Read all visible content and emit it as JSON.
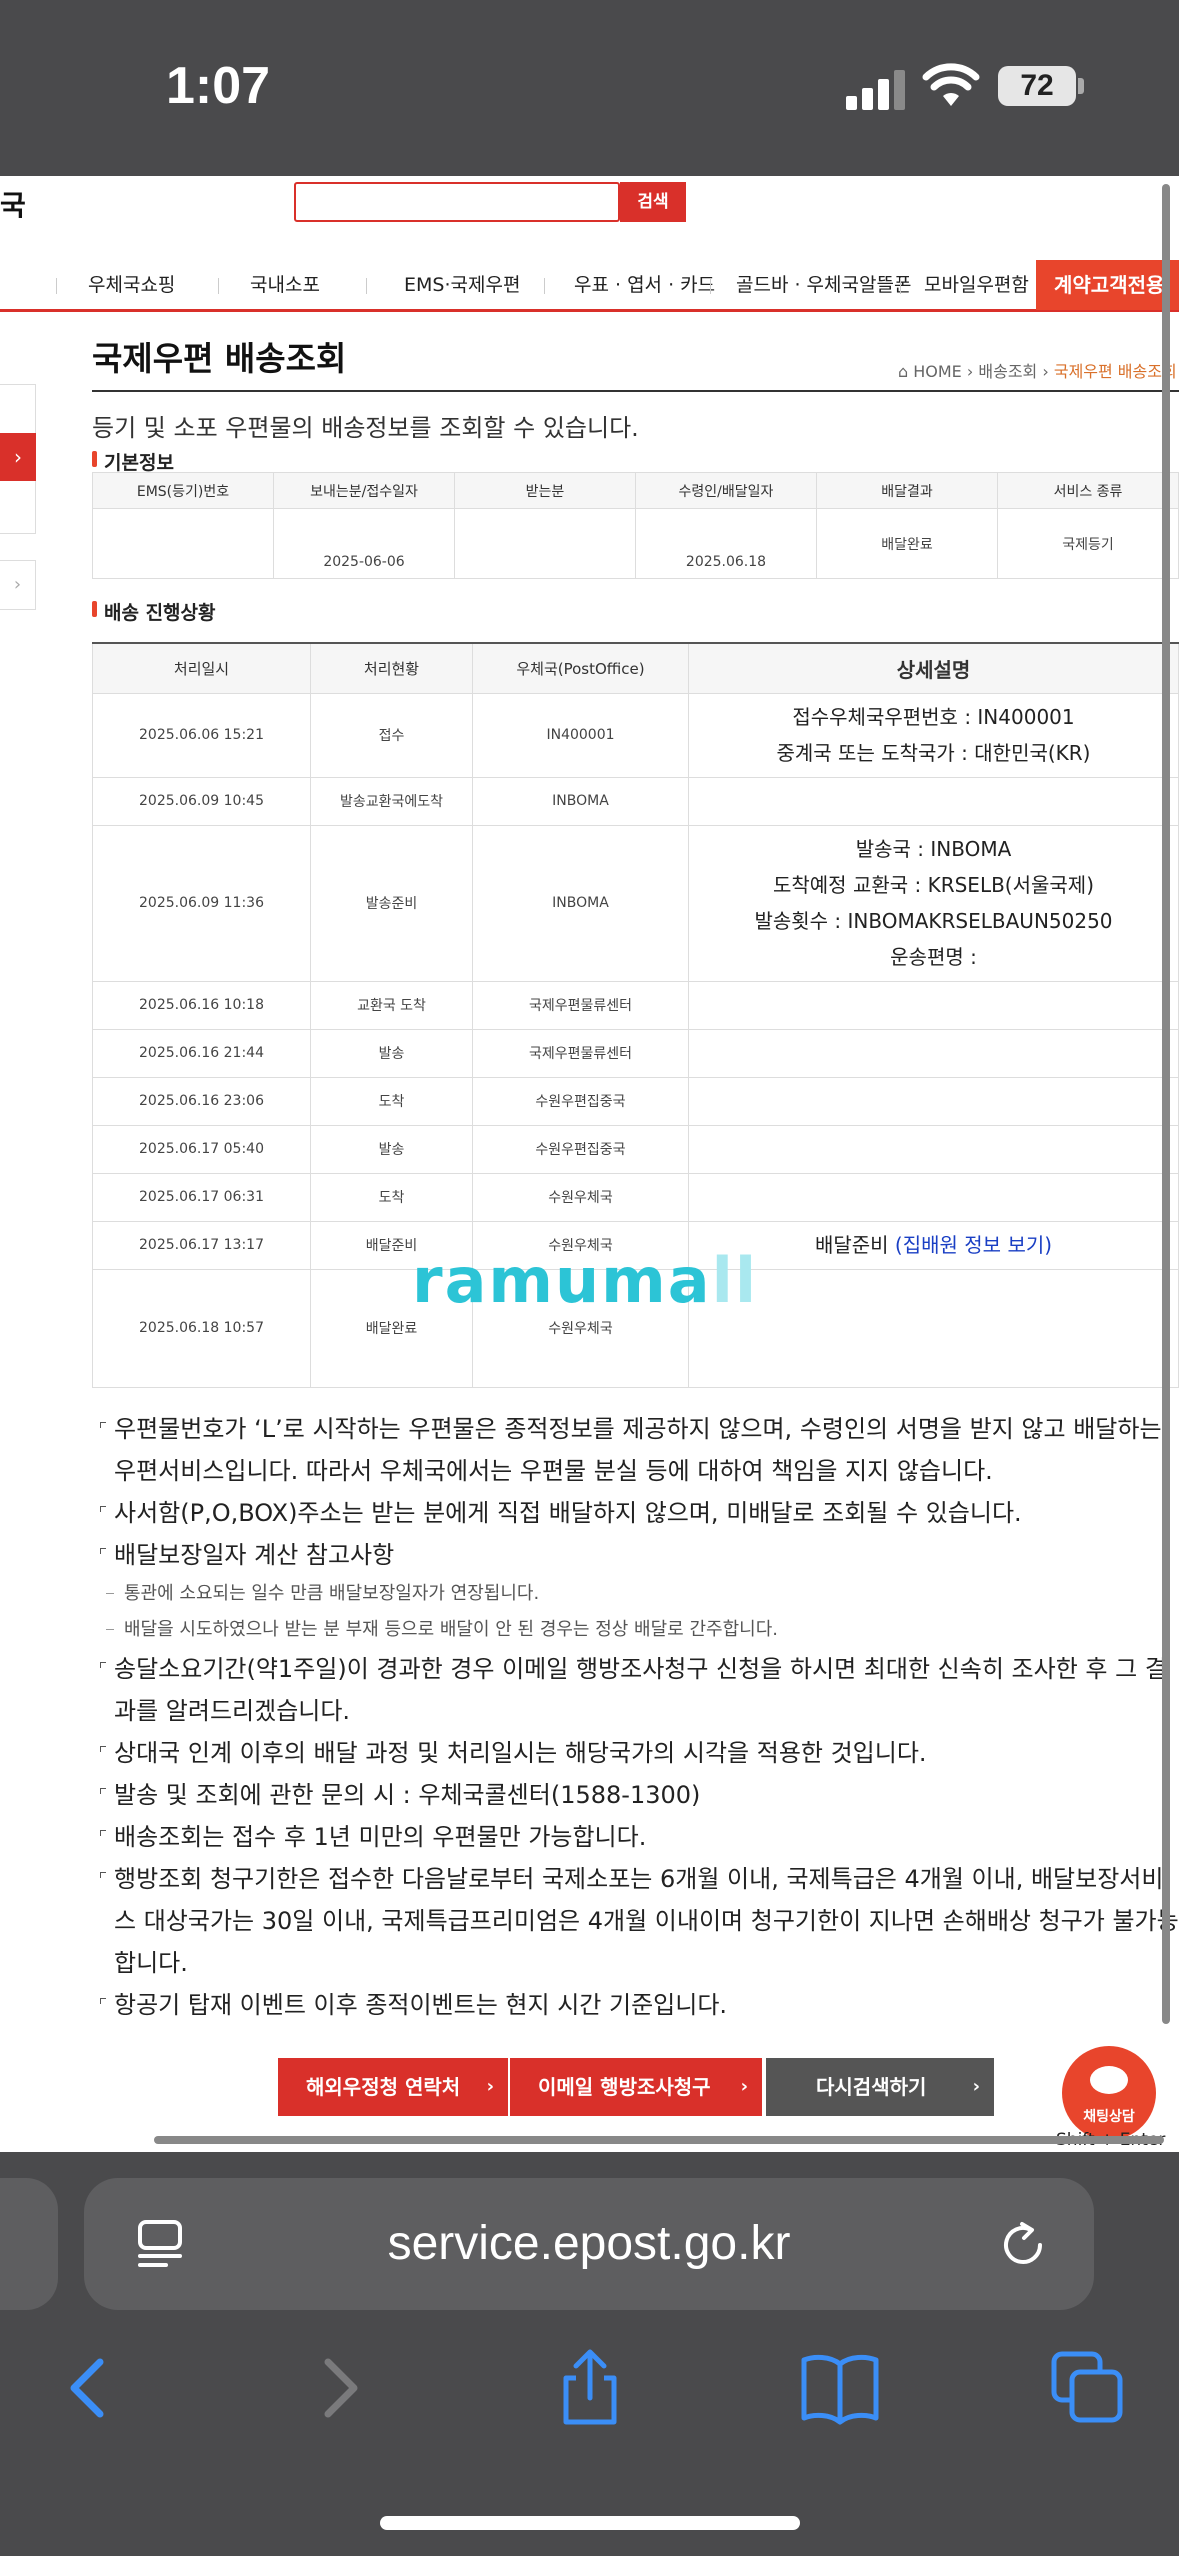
{
  "status": {
    "time": "1:07",
    "battery": "72"
  },
  "header": {
    "logo_fragment": "국",
    "search_button": "검색",
    "search_value": ""
  },
  "gnb": {
    "items": [
      "우체국쇼핑",
      "국내소포",
      "EMS·국제우편",
      "우표 · 엽서 · 카드",
      "골드바 · 우체국알뜰폰",
      "모바일우편함"
    ],
    "special": "계약고객전용"
  },
  "side": {
    "arrow": "›"
  },
  "page": {
    "title": "국제우편 배송조회",
    "breadcrumb": {
      "home": "HOME",
      "mid": "배송조회",
      "current": "국제우편 배송조회"
    },
    "intro": "등기 및 소포 우편물의 배송정보를 조회할 수 있습니다."
  },
  "basic": {
    "heading": "기본정보",
    "columns": [
      "EMS(등기)번호",
      "보내는분/접수일자",
      "받는분",
      "수령인/배달일자",
      "배달결과",
      "서비스 종류"
    ],
    "row": [
      "",
      "2025-06-06",
      "",
      "2025.06.18",
      "배달완료",
      "국제등기"
    ]
  },
  "tracking": {
    "heading": "배송 진행상황",
    "columns": [
      "처리일시",
      "처리현황",
      "우체국(PostOffice)",
      "상세설명"
    ],
    "rows": [
      {
        "time": "2025.06.06 15:21",
        "status": "접수",
        "office": "IN400001",
        "desc": [
          "접수우체국우편번호 : IN400001",
          "중계국 또는 도착국가 : 대한민국(KR)"
        ]
      },
      {
        "time": "2025.06.09 10:45",
        "status": "발송교환국에도착",
        "office": "INBOMA",
        "desc": []
      },
      {
        "time": "2025.06.09 11:36",
        "status": "발송준비",
        "office": "INBOMA",
        "desc": [
          "발송국 : INBOMA",
          "도착예정 교환국 : KRSELB(서울국제)",
          "발송횟수 : INBOMAKRSELBAUN50250",
          "운송편명 :"
        ]
      },
      {
        "time": "2025.06.16 10:18",
        "status": "교환국 도착",
        "office": "국제우편물류센터",
        "desc": []
      },
      {
        "time": "2025.06.16 21:44",
        "status": "발송",
        "office": "국제우편물류센터",
        "desc": []
      },
      {
        "time": "2025.06.16 23:06",
        "status": "도착",
        "office": "수원우편집중국",
        "desc": []
      },
      {
        "time": "2025.06.17 05:40",
        "status": "발송",
        "office": "수원우편집중국",
        "desc": []
      },
      {
        "time": "2025.06.17 06:31",
        "status": "도착",
        "office": "수원우체국",
        "desc": []
      },
      {
        "time": "2025.06.17 13:17",
        "status": "배달준비",
        "office": "수원우체국",
        "desc": [
          "배달준비"
        ],
        "link": "(집배원 정보 보기)"
      },
      {
        "time": "2025.06.18 10:57",
        "status": "배달완료",
        "office": "수원우체국",
        "desc": []
      }
    ]
  },
  "watermark": {
    "main": "ramuma",
    "faded": "ll"
  },
  "notes": [
    {
      "text": "우편물번호가 ‘L’로 시작하는 우편물은 종적정보를 제공하지 않으며, 수령인의 서명을 받지 않고 배달하는 우편서비스입니다. 따라서 우체국에서는 우편물 분실 등에 대하여 책임을 지지 않습니다.",
      "sub": false
    },
    {
      "text": "사서함(P,O,BOX)주소는 받는 분에게 직접 배달하지 않으며, 미배달로 조회될 수 있습니다.",
      "sub": false
    },
    {
      "text": "배달보장일자 계산 참고사항",
      "sub": false
    },
    {
      "text": "통관에 소요되는 일수 만큼 배달보장일자가 연장됩니다.",
      "sub": true
    },
    {
      "text": "배달을 시도하였으나 받는 분 부재 등으로 배달이 안 된 경우는 정상 배달로 간주합니다.",
      "sub": true
    },
    {
      "text": "송달소요기간(약1주일)이 경과한 경우 이메일 행방조사청구 신청을 하시면 최대한 신속히 조사한 후 그 결과를 알려드리겠습니다.",
      "sub": false
    },
    {
      "text": "상대국 인계 이후의 배달 과정 및 처리일시는 해당국가의 시각을 적용한 것입니다.",
      "sub": false
    },
    {
      "text": "발송 및 조회에 관한 문의 시 : 우체국콜센터(1588-1300)",
      "sub": false
    },
    {
      "text": "배송조회는 접수 후 1년 미만의 우편물만 가능합니다.",
      "sub": false
    },
    {
      "text": "행방조회 청구기한은 접수한 다음날로부터 국제소포는 6개월 이내, 국제특급은 4개월 이내, 배달보장서비스 대상국가는 30일 이내, 국제특급프리미엄은 4개월 이내이며 청구기한이 지나면 손해배상 청구가 불가능합니다.",
      "sub": false
    },
    {
      "text": "항공기 탑재 이벤트 이후 종적이벤트는 현지 시간 기준입니다.",
      "sub": false
    }
  ],
  "buttons": {
    "overseas": "해외우정청 연락처",
    "email": "이메일 행방조사청구",
    "research": "다시검색하기",
    "arrow": "›"
  },
  "chat": {
    "label": "채팅상담",
    "hint": "Shift + Enter"
  },
  "browser": {
    "url": "service.epost.go.kr"
  },
  "colors": {
    "brand_red": "#d9302a",
    "accent_orange": "#e8452c",
    "link_blue": "#1a3fc4",
    "gray_button": "#555555",
    "watermark": "#2cc4d6"
  }
}
